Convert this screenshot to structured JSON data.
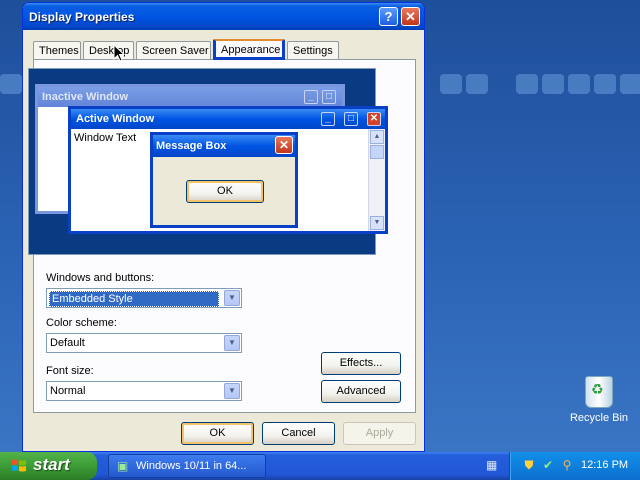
{
  "dialog": {
    "title": "Display Properties",
    "help_glyph": "?",
    "close_glyph": "✕",
    "tabs": [
      {
        "label": "Themes",
        "active": false
      },
      {
        "label": "Desktop",
        "active": false
      },
      {
        "label": "Screen Saver",
        "active": false
      },
      {
        "label": "Appearance",
        "active": true
      },
      {
        "label": "Settings",
        "active": false
      }
    ],
    "preview": {
      "inactive_title": "Inactive Window",
      "active_title": "Active Window",
      "window_text": "Window Text",
      "message_title": "Message Box",
      "message_ok": "OK",
      "min_glyph": "_",
      "max_glyph": "□",
      "close_glyph": "✕"
    },
    "windows_buttons_label": "Windows and buttons:",
    "windows_buttons_value": "Embedded Style",
    "color_scheme_label": "Color scheme:",
    "color_scheme_value": "Default",
    "font_size_label": "Font size:",
    "font_size_value": "Normal",
    "effects_label": "Effects...",
    "advanced_label": "Advanced",
    "ok_label": "OK",
    "cancel_label": "Cancel",
    "apply_label": "Apply"
  },
  "desktop": {
    "recycle_bin_label": "Recycle Bin"
  },
  "taskbar": {
    "start_label": "start",
    "task_label": "Windows 10/11 in 64...",
    "clock": "12:16 PM"
  },
  "colors": {
    "titlebar_blue": "#0054e3",
    "dialog_face": "#ece9d8",
    "selection": "#316ac5",
    "start_green": "#3c9c36",
    "tray_blue": "#0c6fd0"
  }
}
